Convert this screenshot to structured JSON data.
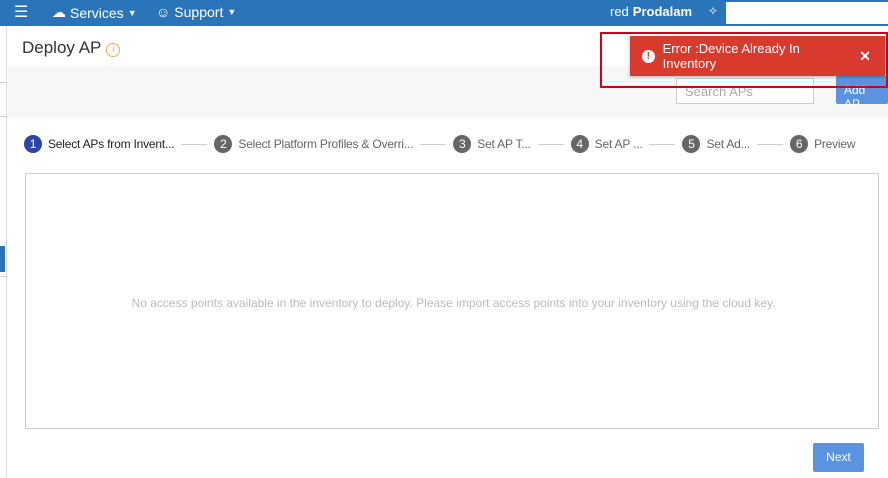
{
  "topbar": {
    "services": "Services",
    "support": "Support",
    "user_prefix": "red",
    "user_name": "Prodalam"
  },
  "page": {
    "title": "Deploy AP",
    "info_icon": "i"
  },
  "toolbar": {
    "search_placeholder": "Search APs",
    "add_ap": "Add AP"
  },
  "toast": {
    "message": "Error :Device Already In Inventory",
    "close": "✕",
    "icon": "!"
  },
  "steps": [
    {
      "n": "1",
      "label": "Select APs from Invent..."
    },
    {
      "n": "2",
      "label": "Select Platform Profiles & Overri..."
    },
    {
      "n": "3",
      "label": "Set AP T..."
    },
    {
      "n": "4",
      "label": "Set AP ..."
    },
    {
      "n": "5",
      "label": "Set Ad..."
    },
    {
      "n": "6",
      "label": "Preview"
    }
  ],
  "main": {
    "empty_message": "No access points available in the inventory to deploy. Please import access points into your inventory using the cloud key.",
    "next": "Next"
  },
  "colors": {
    "brand": "#2a74b9",
    "error": "#d83a2e",
    "active_step": "#2f44a8"
  }
}
